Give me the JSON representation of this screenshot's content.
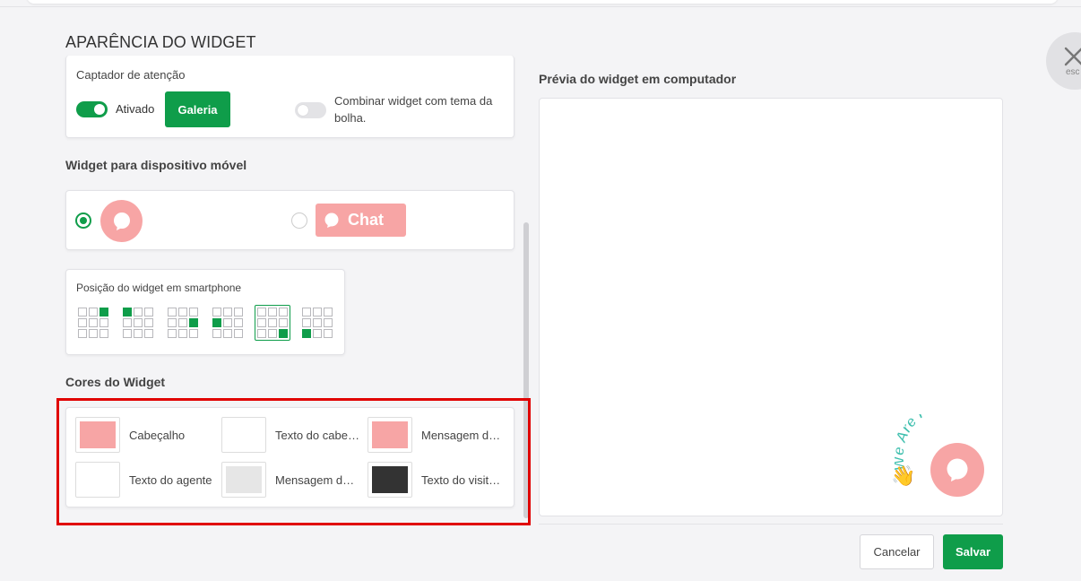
{
  "dialog": {
    "title": "APARÊNCIA DO WIDGET",
    "close_label": "esc"
  },
  "attention": {
    "label": "Captador de atenção",
    "toggle_on": true,
    "toggle_label": "Ativado",
    "gallery_button": "Galeria",
    "theme_toggle_on": false,
    "theme_label": "Combinar widget com tema da bolha."
  },
  "mobile": {
    "heading": "Widget para dispositivo móvel",
    "options": [
      {
        "type": "bubble",
        "selected": true
      },
      {
        "type": "chat-bar",
        "selected": false,
        "label": "Chat"
      }
    ]
  },
  "position": {
    "label": "Posição do widget em smartphone",
    "selected_index": 4
  },
  "colors": {
    "heading": "Cores do Widget",
    "items": [
      {
        "label": "Cabeçalho",
        "color": "#f7a5a5"
      },
      {
        "label": "Texto do cabeçalho",
        "color": "#ffffff"
      },
      {
        "label": "Mensagem do agente",
        "color": "#f7a5a5"
      },
      {
        "label": "Texto do agente",
        "color": "#ffffff"
      },
      {
        "label": "Mensagem do visitante",
        "color": "#e6e6e6"
      },
      {
        "label": "Texto do visitante",
        "color": "#333333"
      }
    ]
  },
  "preview": {
    "heading": "Prévia do widget em computador",
    "attention_text": "We Are Here!",
    "bubble_color": "#f7a5a5"
  },
  "footer": {
    "cancel_label": "Cancelar",
    "save_label": "Salvar"
  },
  "accent_color": "#0f9d4a",
  "highlight_color": "#e00000"
}
